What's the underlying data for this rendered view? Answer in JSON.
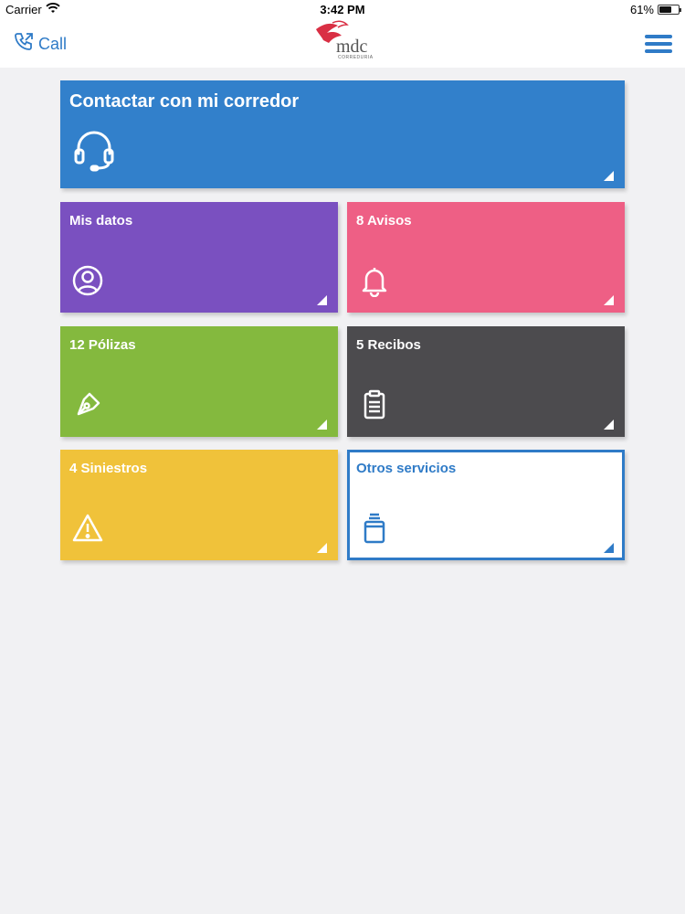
{
  "status_bar": {
    "carrier": "Carrier",
    "time": "3:42 PM",
    "battery": "61%",
    "battery_level": 0.61
  },
  "nav": {
    "call_label": "Call",
    "logo_text": "mdc",
    "logo_sub": "CORREDURIA",
    "icons": {
      "call": "phone-outgoing-icon",
      "menu": "hamburger-menu-icon"
    }
  },
  "tiles": {
    "contact": {
      "label": "Contactar con mi corredor",
      "icon": "headset-icon",
      "color": "#3280cb"
    },
    "datos": {
      "label": "Mis datos",
      "icon": "user-circle-icon",
      "color": "#7a50c0"
    },
    "avisos": {
      "label": "8 Avisos",
      "icon": "bell-icon",
      "color": "#ee5f85"
    },
    "polizas": {
      "label": "12 Pólizas",
      "icon": "pen-nib-icon",
      "color": "#84b93e"
    },
    "recibos": {
      "label": "5 Recibos",
      "icon": "clipboard-icon",
      "color": "#4c4b4e"
    },
    "siniestros": {
      "label": "4 Siniestros",
      "icon": "warning-icon",
      "color": "#f0c23a"
    },
    "otros": {
      "label": "Otros servicios",
      "icon": "jar-icon",
      "color": "#2f7bc7"
    }
  }
}
